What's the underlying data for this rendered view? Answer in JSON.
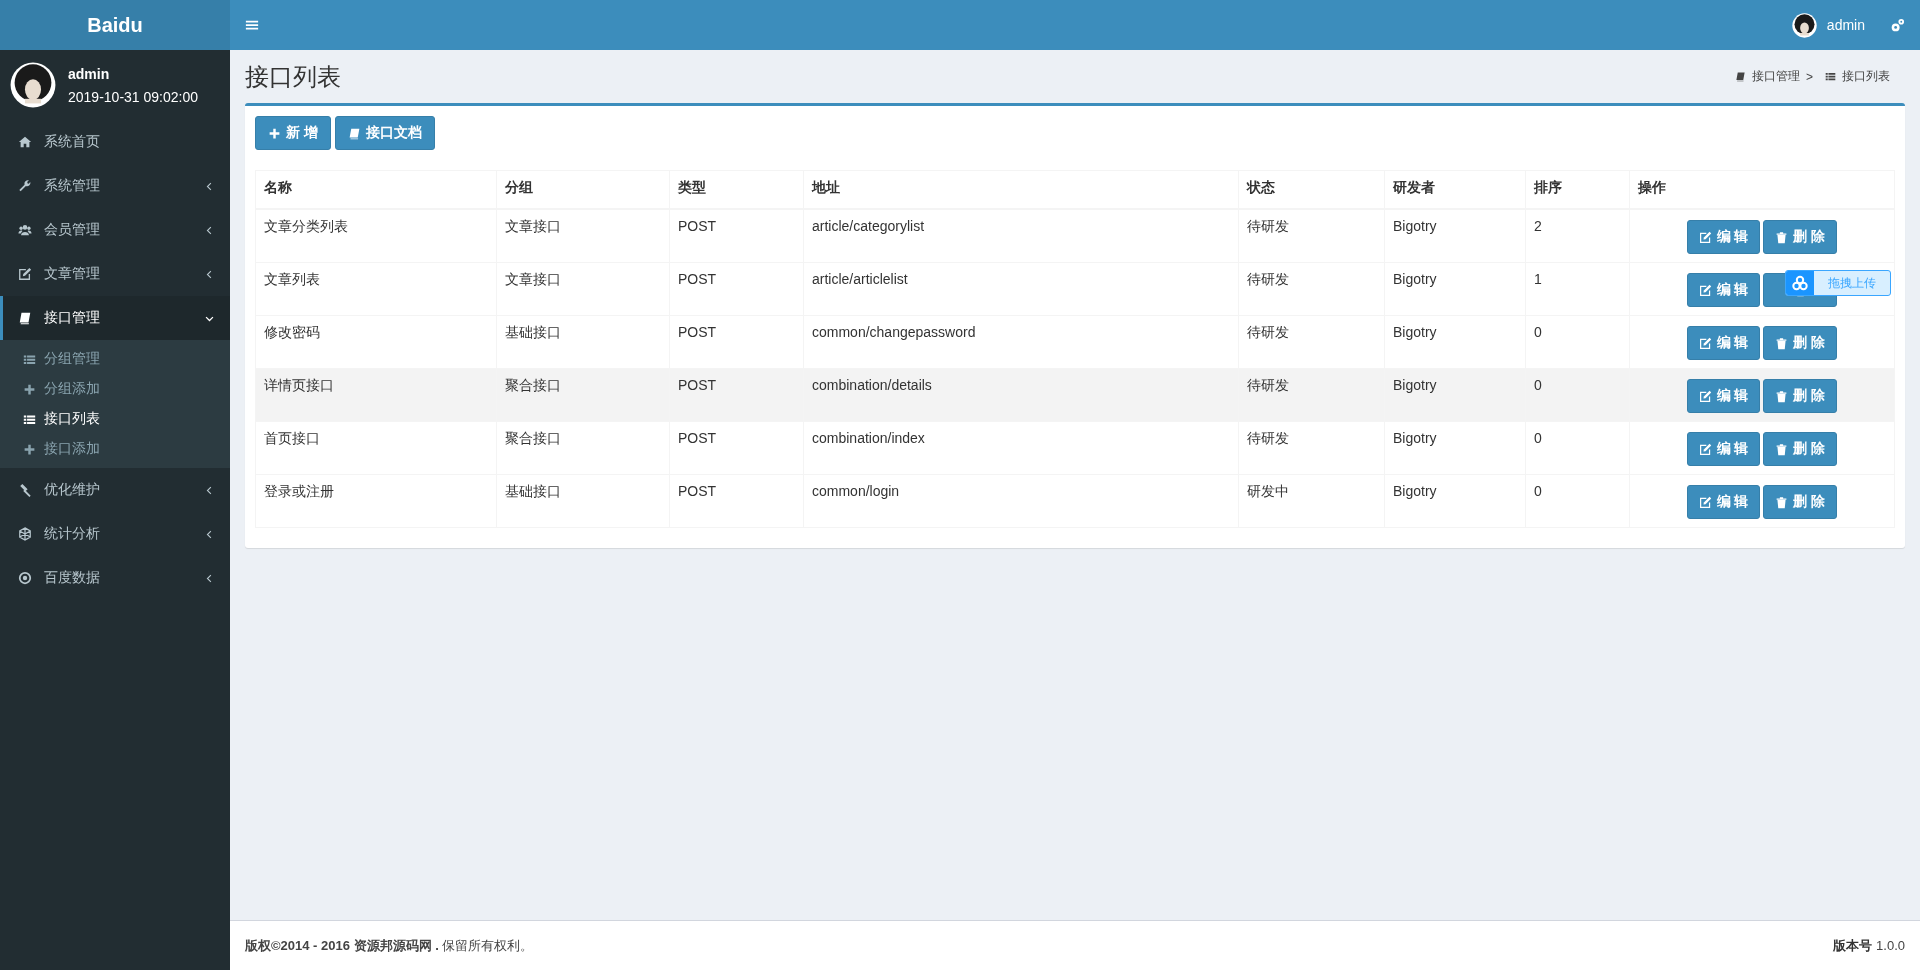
{
  "brand": "Baidu",
  "header": {
    "user": "admin"
  },
  "user_panel": {
    "name": "admin",
    "login_time": "2019-10-31 09:02:00"
  },
  "sidebar": {
    "items": [
      {
        "label": "系统首页",
        "has_children": false,
        "selected": false
      },
      {
        "label": "系统管理",
        "expanded": false,
        "has_children": true,
        "selected": false
      },
      {
        "label": "会员管理",
        "expanded": false,
        "has_children": true,
        "selected": false
      },
      {
        "label": "文章管理",
        "expanded": false,
        "has_children": true,
        "selected": false
      },
      {
        "label": "接口管理",
        "expanded": true,
        "has_children": true,
        "selected": true,
        "children": [
          {
            "label": "分组管理",
            "kind": "list",
            "selected": false
          },
          {
            "label": "分组添加",
            "kind": "add",
            "selected": false
          },
          {
            "label": "接口列表",
            "kind": "list",
            "selected": true
          },
          {
            "label": "接口添加",
            "kind": "add",
            "selected": false
          }
        ]
      },
      {
        "label": "优化维护",
        "expanded": false,
        "has_children": true,
        "selected": false
      },
      {
        "label": "统计分析",
        "expanded": false,
        "has_children": true,
        "selected": false
      },
      {
        "label": "百度数据",
        "expanded": false,
        "has_children": true,
        "selected": false
      }
    ]
  },
  "page_title": "接口列表",
  "breadcrumb": [
    "接口管理",
    "接口列表"
  ],
  "breadcrumb_separator": ">",
  "toolbar": [
    "新 增",
    "接口文档"
  ],
  "table": {
    "columns": [
      "名称",
      "分组",
      "类型",
      "地址",
      "状态",
      "研发者",
      "排序",
      "操作"
    ],
    "rows": [
      {
        "cells": [
          "文章分类列表",
          "文章接口",
          "POST",
          "article/categorylist",
          "待研发",
          "Bigotry",
          "2"
        ],
        "edit": "编 辑",
        "delete": "删 除",
        "hovered": false
      },
      {
        "cells": [
          "文章列表",
          "文章接口",
          "POST",
          "article/articlelist",
          "待研发",
          "Bigotry",
          "1"
        ],
        "edit": "编 辑",
        "hovered": false
      },
      {
        "cells": [
          "修改密码",
          "基础接口",
          "POST",
          "common/changepassword",
          "待研发",
          "Bigotry",
          "0"
        ],
        "edit": "编 辑",
        "delete": "删 除",
        "hovered": false
      },
      {
        "cells": [
          "详情页接口",
          "聚合接口",
          "POST",
          "combination/details",
          "待研发",
          "Bigotry",
          "0"
        ],
        "edit": "编 辑",
        "delete": "删 除",
        "hovered": true
      },
      {
        "cells": [
          "首页接口",
          "聚合接口",
          "POST",
          "combination/index",
          "待研发",
          "Bigotry",
          "0"
        ],
        "edit": "编 辑",
        "delete": "删 除",
        "hovered": false
      },
      {
        "cells": [
          "登录或注册",
          "基础接口",
          "POST",
          "common/login",
          "研发中",
          "Bigotry",
          "0"
        ],
        "edit": "编 辑",
        "delete": "删 除",
        "hovered": false
      }
    ]
  },
  "upload_widget": {
    "label": "拖拽上传"
  },
  "footer": {
    "copyright": "**版权©2014 - 2016 资源邦源码网 .** 保留所有权利。",
    "version": "**版本号** 1.0.0"
  }
}
